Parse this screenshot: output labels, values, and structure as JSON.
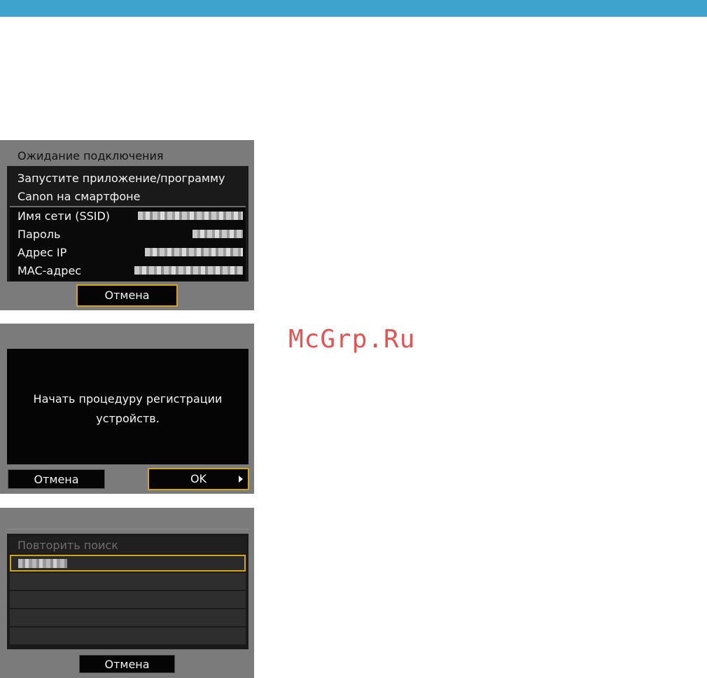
{
  "colors": {
    "top_bar": "#3ea3cd",
    "screen_bg": "#7b7b7b",
    "selection_border": "#d4a417",
    "watermark": "#e25454"
  },
  "screen1": {
    "title": "Ожидание подключения",
    "instruction_line1": "Запустите приложение/программу",
    "instruction_line2": "Canon на смартфоне",
    "info": [
      {
        "label": "Имя сети (SSID)"
      },
      {
        "label": "Пароль"
      },
      {
        "label": "Адрес IP"
      },
      {
        "label": "MAC-адрес"
      }
    ],
    "cancel_label": "Отмена"
  },
  "screen2": {
    "message_line1": "Начать процедуру регистрации",
    "message_line2": "устройств.",
    "cancel_label": "Отмена",
    "ok_label": "OK"
  },
  "screen3": {
    "retry_label": "Повторить поиск",
    "cancel_label": "Отмена"
  },
  "watermark": "McGrp.Ru"
}
